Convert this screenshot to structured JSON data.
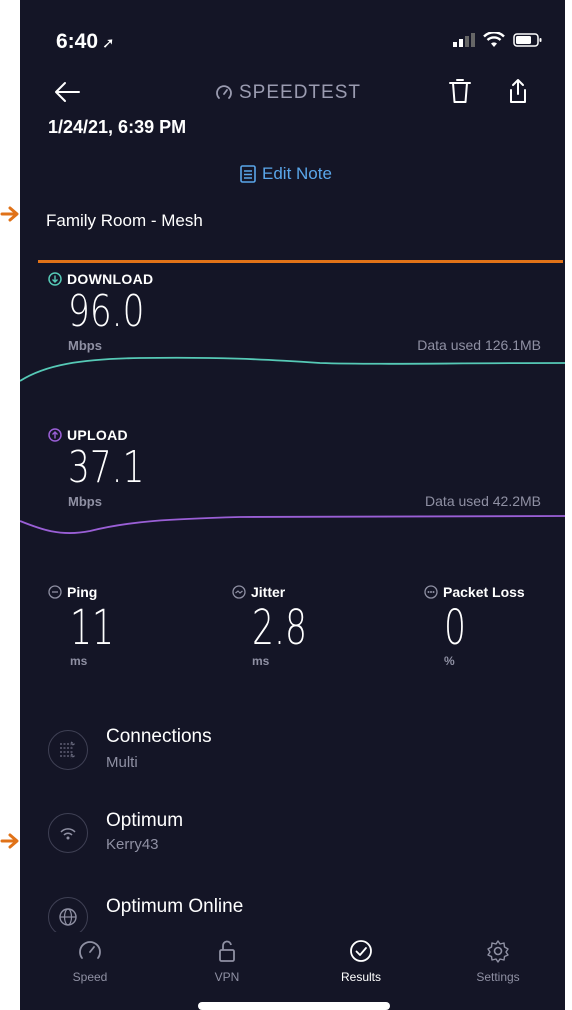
{
  "status_bar": {
    "time": "6:40"
  },
  "header": {
    "brand": "SPEEDTEST",
    "datetime": "1/24/21, 6:39 PM"
  },
  "note": {
    "edit_label": "Edit Note",
    "text": "Family Room - Mesh"
  },
  "download": {
    "label": "DOWNLOAD",
    "value": "96.0",
    "unit": "Mbps",
    "data_used": "Data used 126.1MB",
    "color": "#56c9b6"
  },
  "upload": {
    "label": "UPLOAD",
    "value": "37.1",
    "unit": "Mbps",
    "data_used": "Data used 42.2MB",
    "color": "#9a5fd6"
  },
  "stats": {
    "ping": {
      "label": "Ping",
      "value": "11",
      "unit": "ms"
    },
    "jitter": {
      "label": "Jitter",
      "value": "2.8",
      "unit": "ms"
    },
    "packet_loss": {
      "label": "Packet Loss",
      "value": "0",
      "unit": "%"
    }
  },
  "info": {
    "connections": {
      "title": "Connections",
      "sub": "Multi"
    },
    "network": {
      "title": "Optimum",
      "sub": "Kerry43"
    },
    "provider": {
      "title": "Optimum Online"
    }
  },
  "tabs": {
    "speed": "Speed",
    "vpn": "VPN",
    "results": "Results",
    "settings": "Settings"
  },
  "colors": {
    "background": "#141526",
    "accent": "#5aa6ea",
    "annotation": "#e07218"
  }
}
